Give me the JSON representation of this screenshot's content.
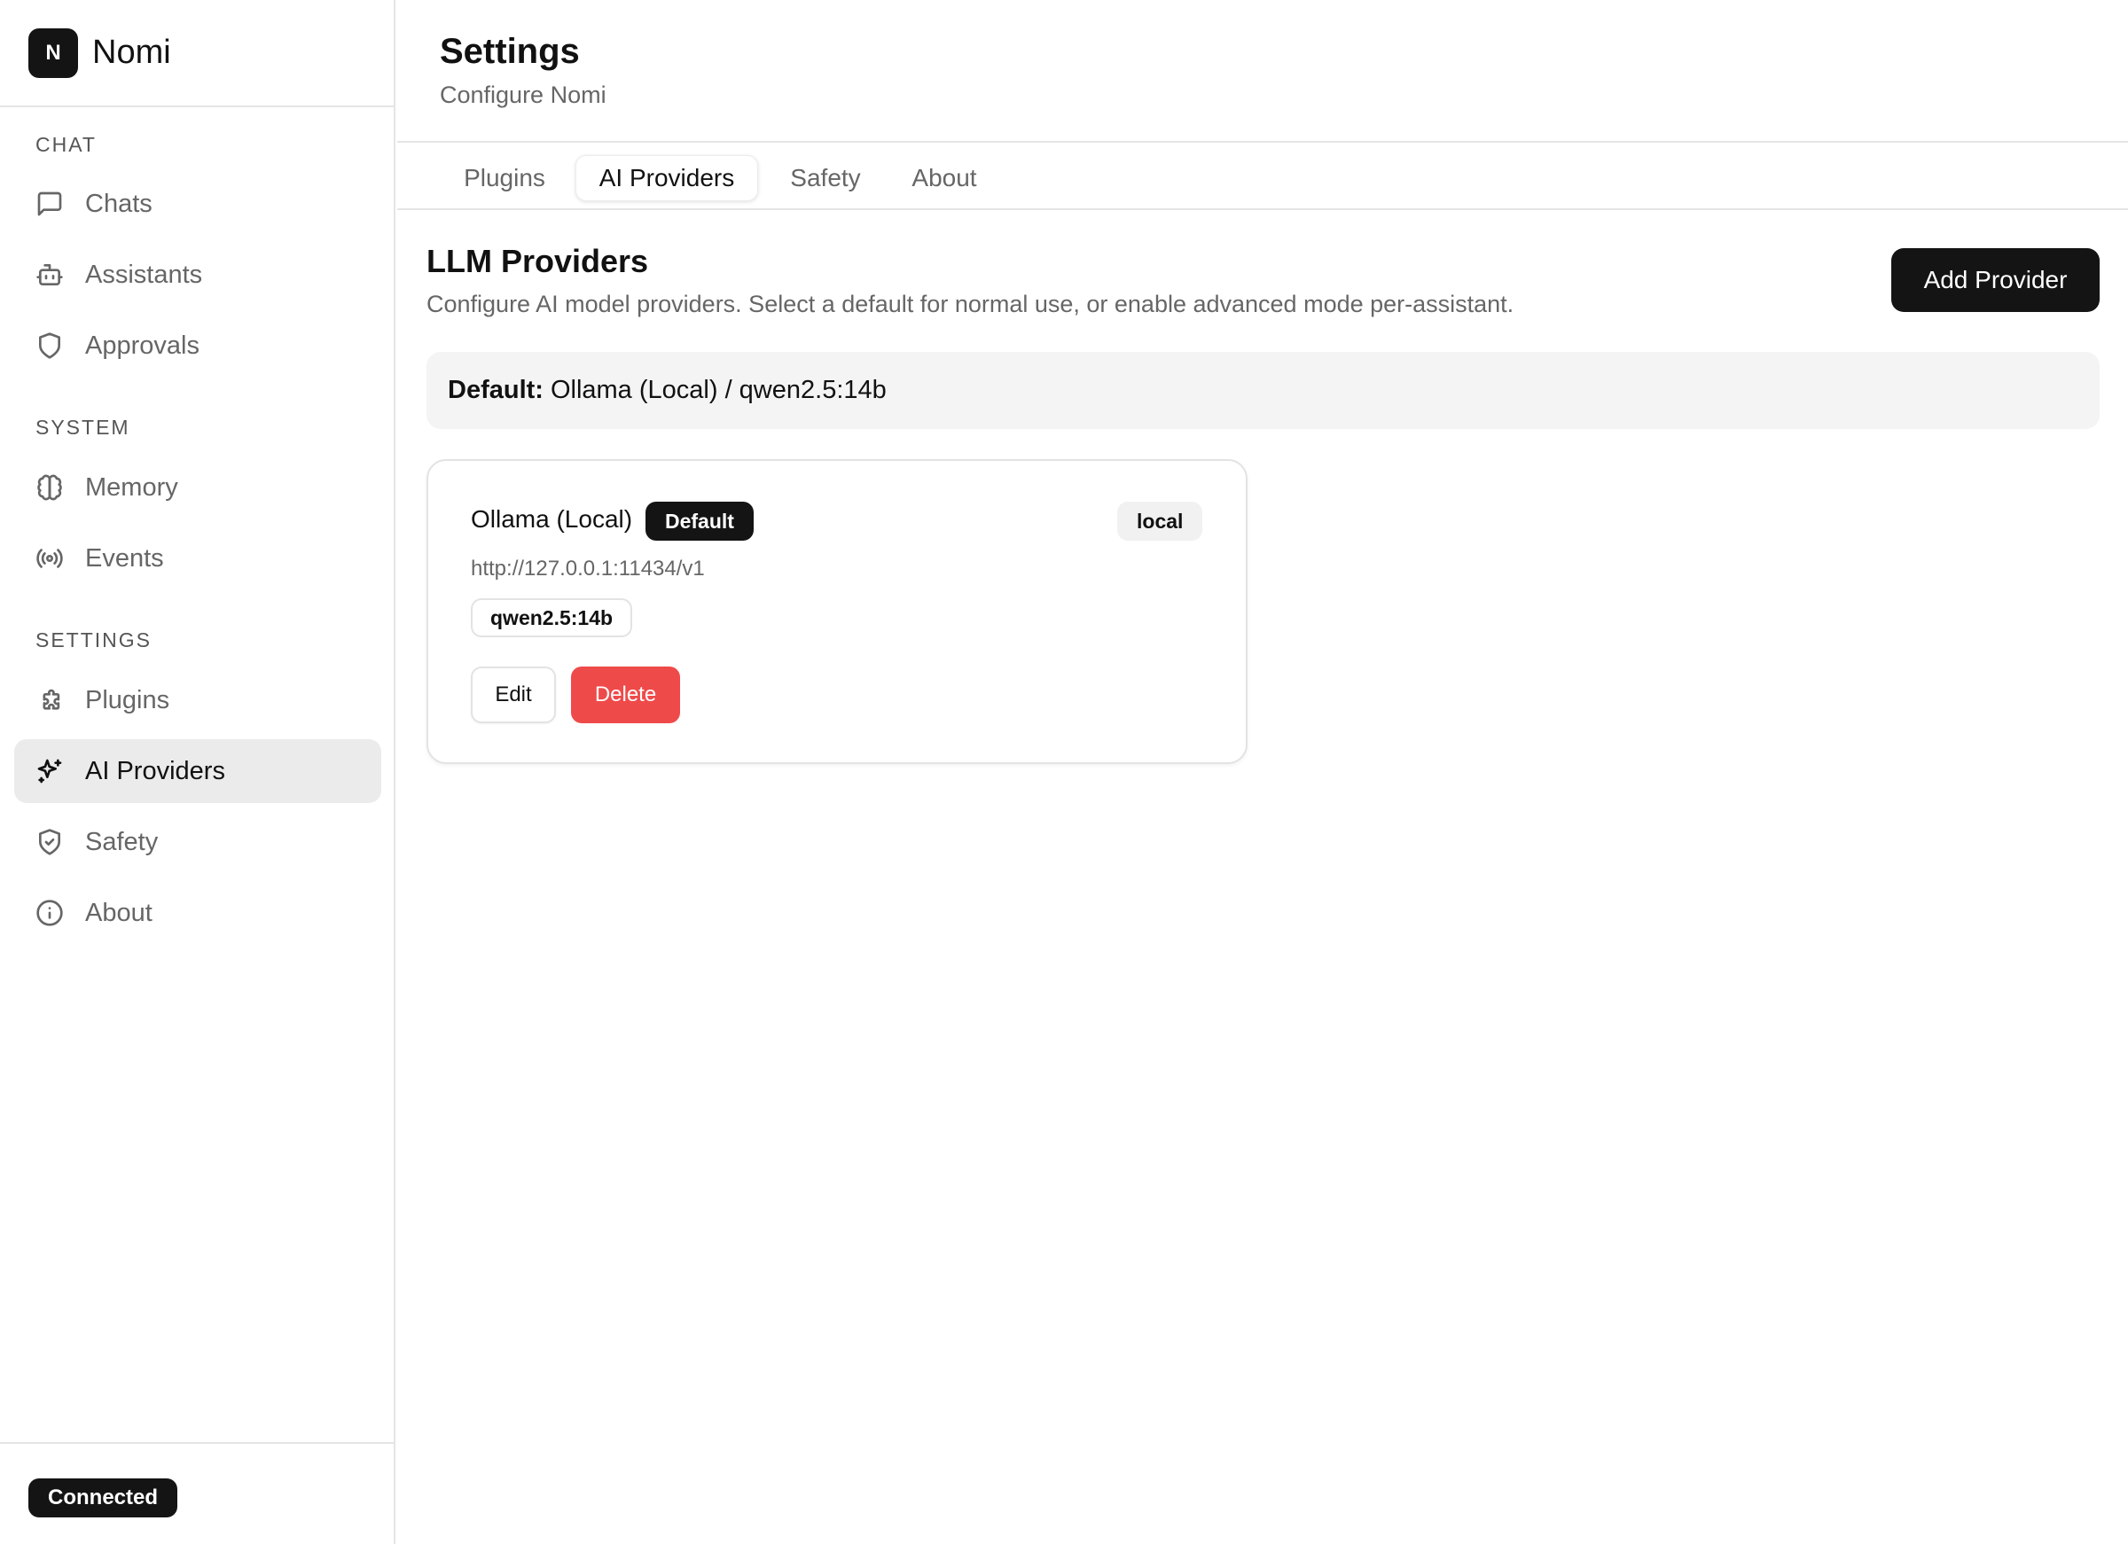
{
  "app": {
    "logo_letter": "N",
    "name": "Nomi"
  },
  "sidebar": {
    "sections": [
      {
        "label": "CHAT"
      },
      {
        "label": "SYSTEM"
      },
      {
        "label": "SETTINGS"
      }
    ],
    "items": [
      {
        "label": "Chats",
        "icon": "message-square-icon"
      },
      {
        "label": "Assistants",
        "icon": "bot-icon"
      },
      {
        "label": "Approvals",
        "icon": "shield-icon"
      },
      {
        "label": "Memory",
        "icon": "brain-icon"
      },
      {
        "label": "Events",
        "icon": "radio-icon"
      },
      {
        "label": "Plugins",
        "icon": "puzzle-icon"
      },
      {
        "label": "AI Providers",
        "icon": "sparkles-icon",
        "active": true
      },
      {
        "label": "Safety",
        "icon": "shield-check-icon"
      },
      {
        "label": "About",
        "icon": "info-icon"
      }
    ],
    "status": "Connected"
  },
  "header": {
    "title": "Settings",
    "subtitle": "Configure Nomi"
  },
  "tabs": [
    {
      "label": "Plugins"
    },
    {
      "label": "AI Providers",
      "active": true
    },
    {
      "label": "Safety"
    },
    {
      "label": "About"
    }
  ],
  "providers": {
    "title": "LLM Providers",
    "description": "Configure AI model providers. Select a default for normal use, or enable advanced mode per-assistant.",
    "add_label": "Add Provider",
    "default_label": "Default:",
    "default_value": "Ollama (Local) / qwen2.5:14b",
    "cards": [
      {
        "name": "Ollama (Local)",
        "default_badge": "Default",
        "type_badge": "local",
        "url": "http://127.0.0.1:11434/v1",
        "model": "qwen2.5:14b",
        "edit_label": "Edit",
        "delete_label": "Delete"
      }
    ]
  },
  "colors": {
    "primary": "#141414",
    "danger": "#ef4a4a",
    "active_nav_bg": "#ebebeb",
    "banner_bg": "#f4f4f4"
  }
}
